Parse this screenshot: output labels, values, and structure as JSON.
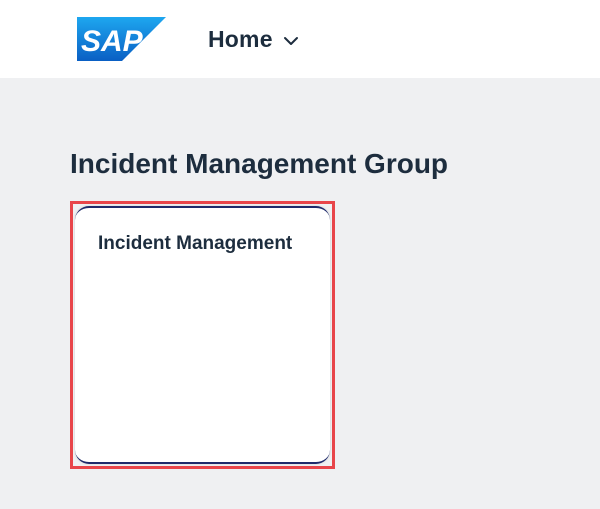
{
  "header": {
    "logo_text": "SAP",
    "logo_icon": "sap-logo",
    "nav_label": "Home",
    "nav_icon": "chevron-down-icon"
  },
  "group": {
    "title": "Incident Management Group",
    "tiles": [
      {
        "title": "Incident Management"
      }
    ]
  },
  "colors": {
    "header_bg": "#ffffff",
    "page_bg": "#eff0f2",
    "text": "#1d2d3e",
    "logo_blue": "#0a6ed1",
    "highlight": "#e8454a",
    "tile_edge": "#1e2a6b"
  }
}
